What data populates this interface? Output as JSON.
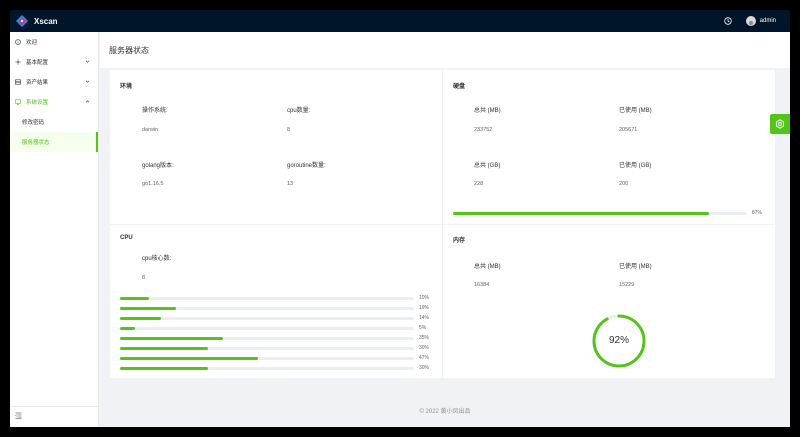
{
  "app": {
    "title": "Xscan",
    "username": "admin"
  },
  "colors": {
    "accent": "#52c41a",
    "header": "#001529"
  },
  "sidebar": {
    "items": [
      {
        "label": "欢迎",
        "icon": "info-circle-icon"
      },
      {
        "label": "基本配置",
        "icon": "settings-icon"
      },
      {
        "label": "资产结果",
        "icon": "table-icon"
      },
      {
        "label": "系统设置",
        "icon": "system-icon"
      }
    ],
    "sub_items": [
      {
        "label": "修改密码"
      },
      {
        "label": "服务器状态"
      }
    ]
  },
  "page": {
    "title": "服务器状态"
  },
  "env": {
    "title": "环境",
    "os_label": "操作系统:",
    "os_value": "darwin",
    "cpu_label": "cpu数量:",
    "cpu_value": "8",
    "golang_label": "golang版本:",
    "golang_value": "go1.16.5",
    "goroutine_label": "goroutine数量:",
    "goroutine_value": "13"
  },
  "disk": {
    "title": "硬盘",
    "total_mb_label": "总共 (MB)",
    "total_mb_value": "233752",
    "used_mb_label": "已使用 (MB)",
    "used_mb_value": "205671",
    "total_gb_label": "总共 (GB)",
    "total_gb_value": "228",
    "used_gb_label": "已使用 (GB)",
    "used_gb_value": "200",
    "usage_percent": 87,
    "usage_label": "87%"
  },
  "cpu": {
    "title": "CPU",
    "cores_label": "cpu核心数:",
    "cores_value": "8",
    "bars": [
      {
        "percent": 10,
        "label": "10%"
      },
      {
        "percent": 19,
        "label": "19%"
      },
      {
        "percent": 14,
        "label": "14%"
      },
      {
        "percent": 5,
        "label": "5%"
      },
      {
        "percent": 35,
        "label": "35%"
      },
      {
        "percent": 30,
        "label": "30%"
      },
      {
        "percent": 47,
        "label": "47%"
      },
      {
        "percent": 30,
        "label": "30%"
      }
    ]
  },
  "memory": {
    "title": "内存",
    "total_label": "总共 (MB)",
    "total_value": "16384",
    "used_label": "已使用 (MB)",
    "used_value": "15229",
    "usage_percent": 92,
    "usage_label": "92%"
  },
  "footer": {
    "text": "© 2022 黄小凤出品"
  }
}
